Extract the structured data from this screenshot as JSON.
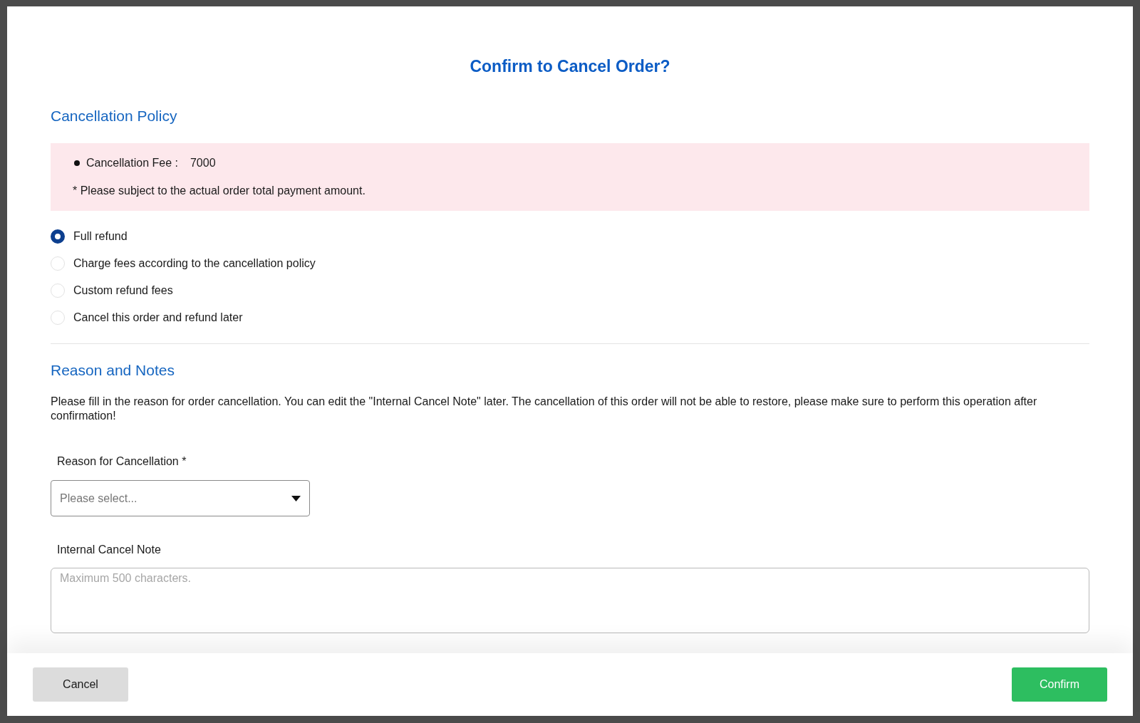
{
  "dialog": {
    "title": "Confirm to Cancel Order?"
  },
  "policy": {
    "heading": "Cancellation Policy",
    "fees": [
      {
        "label": "Cancellation Fee :",
        "value": "7000"
      }
    ],
    "note": "* Please subject to the actual order total payment amount."
  },
  "refund_options": [
    {
      "label": "Full refund",
      "selected": true
    },
    {
      "label": "Charge fees according to the cancellation policy",
      "selected": false
    },
    {
      "label": "Custom refund fees",
      "selected": false
    },
    {
      "label": "Cancel this order and refund later",
      "selected": false
    }
  ],
  "reason_section": {
    "heading": "Reason and Notes",
    "description": "Please fill in the reason for order cancellation. You can edit the \"Internal Cancel Note\" later. The cancellation of this order will not be able to restore, please make sure to perform this operation after confirmation!"
  },
  "reason_field": {
    "label": "Reason for Cancellation *",
    "placeholder": "Please select..."
  },
  "note_field": {
    "label": "Internal Cancel Note",
    "placeholder": "Maximum 500 characters."
  },
  "buttons": [
    {
      "label": "Cancel",
      "kind": "secondary"
    },
    {
      "label": "Confirm",
      "kind": "primary"
    }
  ]
}
